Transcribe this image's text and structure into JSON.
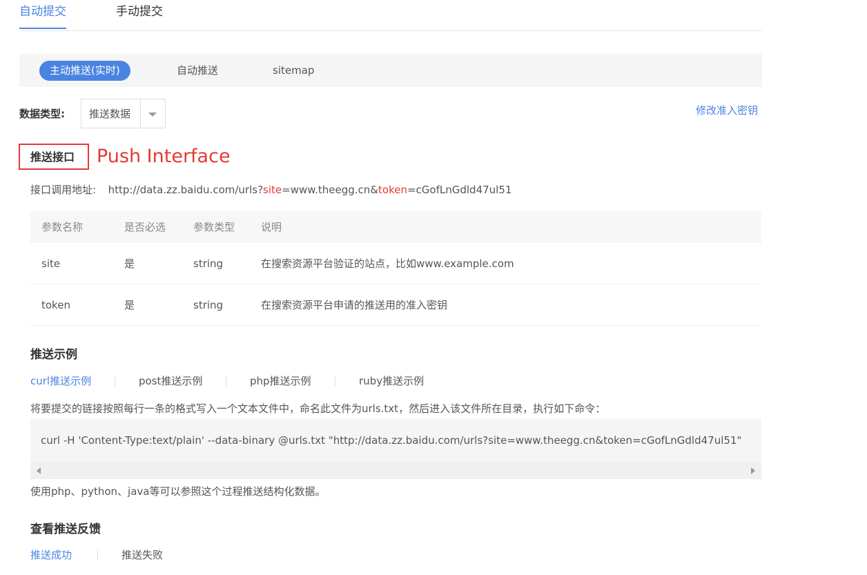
{
  "top_tabs": [
    "自动提交",
    "手动提交"
  ],
  "sub_tabs": [
    "主动推送(实时)",
    "自动推送",
    "sitemap"
  ],
  "data_type": {
    "label": "数据类型:",
    "selected": "推送数据",
    "edit_key_link": "修改准入密钥"
  },
  "push_interface": {
    "heading": "推送接口",
    "annotation": "Push Interface",
    "url_label": "接口调用地址:",
    "url_parts": [
      "http://data.zz.baidu.com/urls?",
      "site",
      "=www.theegg.cn&",
      "token",
      "=cGofLnGdld47ul51"
    ]
  },
  "param_table": {
    "columns": [
      "参数名称",
      "是否必选",
      "参数类型",
      "说明"
    ],
    "rows": [
      [
        "site",
        "是",
        "string",
        "在搜索资源平台验证的站点，比如www.example.com"
      ],
      [
        "token",
        "是",
        "string",
        "在搜索资源平台申请的推送用的准入密钥"
      ]
    ]
  },
  "examples": {
    "heading": "推送示例",
    "tabs": [
      "curl推送示例",
      "post推送示例",
      "php推送示例",
      "ruby推送示例"
    ],
    "description": "将要提交的链接按照每行一条的格式写入一个文本文件中，命名此文件为urls.txt，然后进入该文件所在目录，执行如下命令：",
    "code": "curl -H 'Content-Type:text/plain' --data-binary @urls.txt \"http://data.zz.baidu.com/urls?site=www.theegg.cn&token=cGofLnGdld47ul51\"",
    "note": "使用php、python、java等可以参照这个过程推送结构化数据。"
  },
  "feedback": {
    "heading": "查看推送反馈",
    "tabs": [
      "推送成功",
      "推送失败"
    ]
  },
  "colors": {
    "accent": "#4a84e2",
    "highlight_red": "#e53935"
  }
}
